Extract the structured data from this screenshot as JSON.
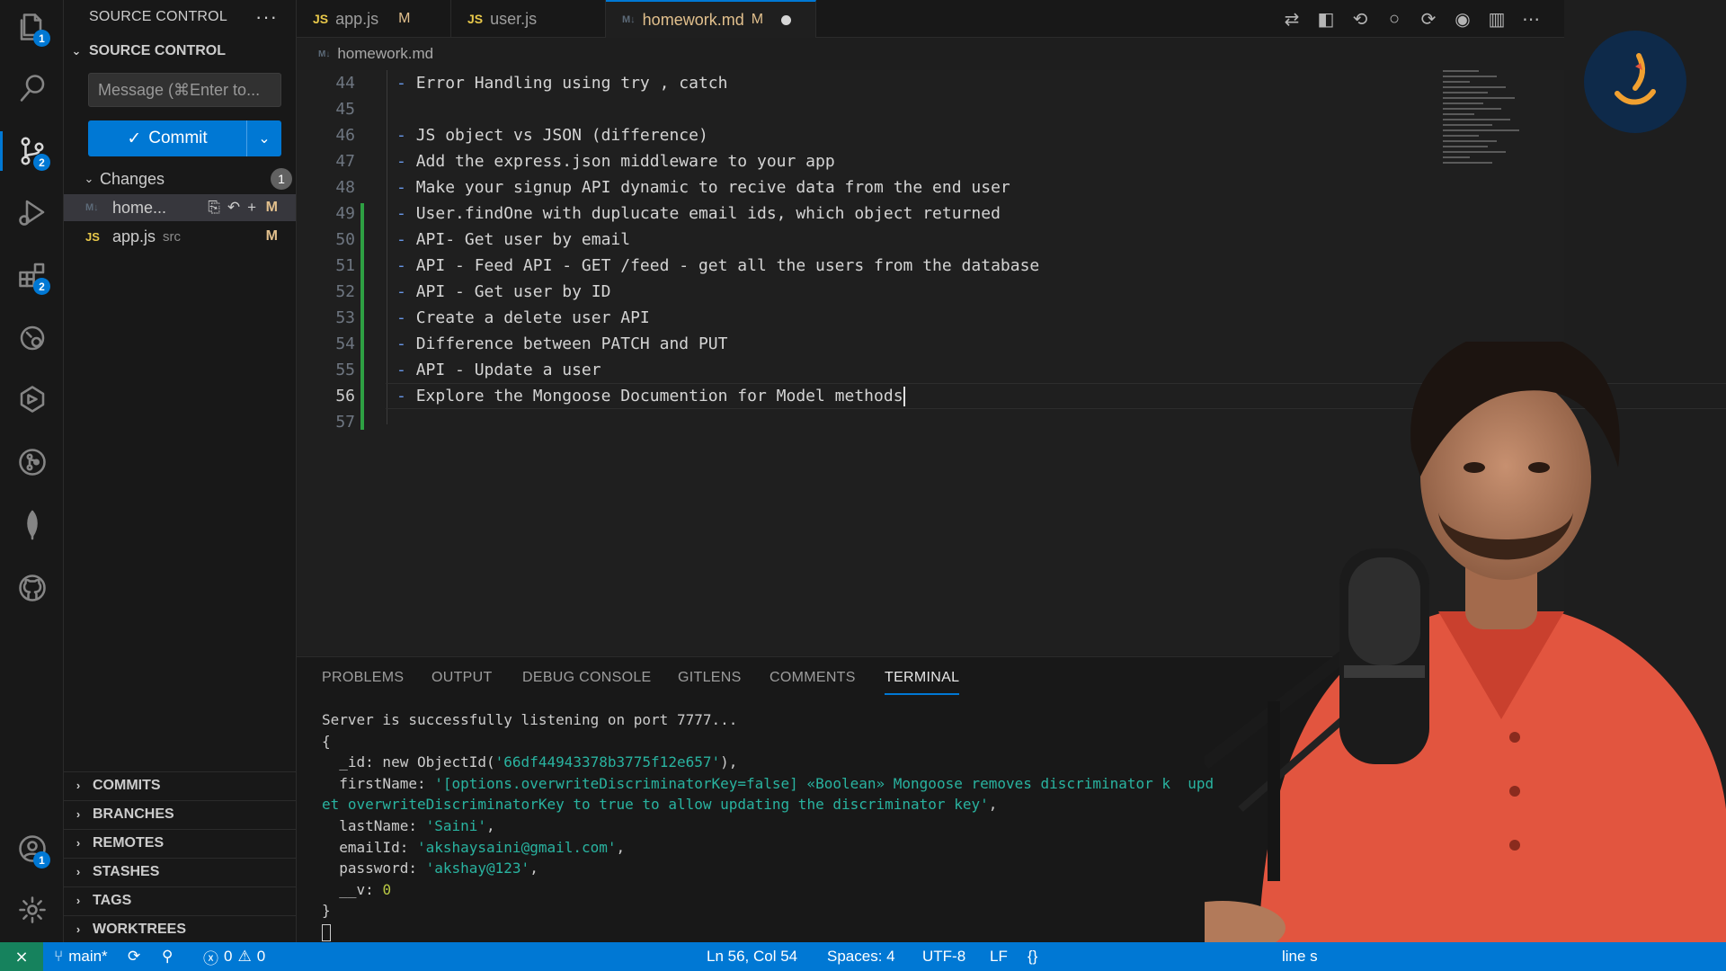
{
  "activity_bar": {
    "items": [
      {
        "name": "explorer",
        "badge": "1"
      },
      {
        "name": "search",
        "badge": ""
      },
      {
        "name": "source-control",
        "badge": "2"
      },
      {
        "name": "run-debug",
        "badge": ""
      },
      {
        "name": "extensions",
        "badge": "2"
      },
      {
        "name": "remote-explorer",
        "badge": ""
      },
      {
        "name": "testing",
        "badge": ""
      },
      {
        "name": "gitlens",
        "badge": ""
      },
      {
        "name": "mongodb",
        "badge": ""
      },
      {
        "name": "github",
        "badge": ""
      }
    ],
    "accounts_badge": "1"
  },
  "sidebar": {
    "header": "SOURCE CONTROL",
    "more": "···",
    "section_title": "SOURCE CONTROL",
    "message_placeholder": "Message (⌘Enter to...",
    "commit_label": "Commit",
    "changes_label": "Changes",
    "changes_count": "1",
    "files": [
      {
        "icon": "M↓",
        "name": "home...",
        "dir": "",
        "status": "M"
      },
      {
        "icon": "JS",
        "name": "app.js",
        "dir": "src",
        "status": "M"
      }
    ],
    "sections": [
      "COMMITS",
      "BRANCHES",
      "REMOTES",
      "STASHES",
      "TAGS",
      "WORKTREES"
    ]
  },
  "tabs": [
    {
      "icon": "JS",
      "label": "app.js",
      "status": "M",
      "active": false
    },
    {
      "icon": "JS",
      "label": "user.js",
      "status": "",
      "active": false
    },
    {
      "icon": "M↓",
      "label": "homework.md",
      "status": "M",
      "active": true
    }
  ],
  "breadcrumb": {
    "icon": "M↓",
    "file": "homework.md"
  },
  "editor": {
    "lines": [
      {
        "n": "44",
        "text": "Error Handling using try , catch"
      },
      {
        "n": "45",
        "text": ""
      },
      {
        "n": "46",
        "text": "JS object vs JSON (difference)"
      },
      {
        "n": "47",
        "text": "Add the express.json middleware to your app"
      },
      {
        "n": "48",
        "text": "Make your signup API dynamic to recive data from the end user"
      },
      {
        "n": "49",
        "text": "User.findOne with duplucate email ids, which object returned"
      },
      {
        "n": "50",
        "text": "API- Get user by email"
      },
      {
        "n": "51",
        "text": "API - Feed API - GET /feed - get all the users from the database"
      },
      {
        "n": "52",
        "text": "API - Get user by ID"
      },
      {
        "n": "53",
        "text": "Create a delete user API"
      },
      {
        "n": "54",
        "text": "Difference between PATCH and PUT"
      },
      {
        "n": "55",
        "text": "API - Update a user"
      },
      {
        "n": "56",
        "text": "Explore the Mongoose Documention for Model methods"
      },
      {
        "n": "57",
        "text": ""
      }
    ],
    "current_line": "56"
  },
  "panel": {
    "tabs": [
      "PROBLEMS",
      "OUTPUT",
      "DEBUG CONSOLE",
      "GITLENS",
      "COMMENTS",
      "TERMINAL"
    ],
    "active_tab": "TERMINAL",
    "terminal": {
      "line1": "Server is successfully listening on port 7777...",
      "open_brace": "{",
      "id_key": "  _id: new ObjectId(",
      "id_val": "'66df44943378b3775f12e657'",
      "id_end": "),",
      "first_key": "  firstName: ",
      "first_val": "'[options.overwriteDiscriminatorKey=false] «Boolean» Mongoose removes discriminator k  upd",
      "first_cont": "et overwriteDiscriminatorKey to true to allow updating the discriminator key'",
      "last_key": "  lastName: ",
      "last_val": "'Saini'",
      "email_key": "  emailId: ",
      "email_val": "'akshaysaini@gmail.com'",
      "pass_key": "  password: ",
      "pass_val": "'akshay@123'",
      "v_key": "  __v: ",
      "v_val": "0",
      "close_brace": "}"
    }
  },
  "status_bar": {
    "branch": "main*",
    "errors": "0",
    "warnings": "0",
    "position": "Ln 56, Col 54",
    "spaces": "Spaces: 4",
    "encoding": "UTF-8",
    "eol": "LF",
    "trailing": "line s"
  },
  "colors": {
    "accent": "#0078d4",
    "modified": "#e2c08d",
    "terminal_string": "#29b3a0",
    "shirt": "#e2553f"
  }
}
